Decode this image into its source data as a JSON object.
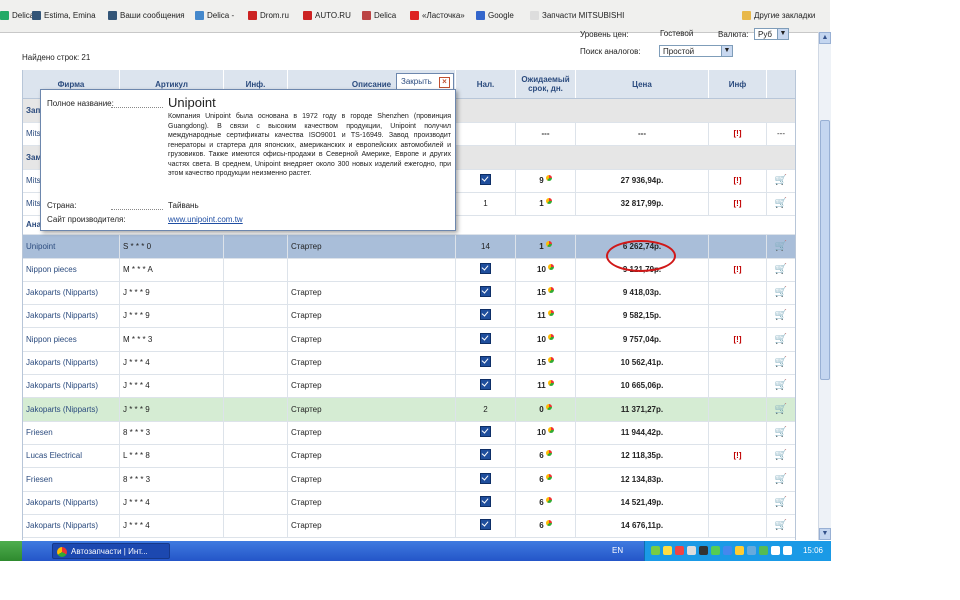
{
  "bookmarks": [
    {
      "label": "Delica",
      "icon": "flag-icon",
      "color": "#2a6"
    },
    {
      "label": "Estima, Emina",
      "icon": "forum-icon",
      "color": "#357"
    },
    {
      "label": "Ваши сообщения",
      "icon": "forum-icon",
      "color": "#357"
    },
    {
      "label": "Delica -",
      "icon": "page-icon",
      "color": "#48c"
    },
    {
      "label": "Drom.ru",
      "icon": "drom-icon",
      "color": "#c22"
    },
    {
      "label": "AUTO.RU",
      "icon": "autoru-icon",
      "color": "#c22"
    },
    {
      "label": "Delica",
      "icon": "page-icon",
      "color": "#b44"
    },
    {
      "label": "«Ласточка»",
      "icon": "page-icon",
      "color": "#d22"
    },
    {
      "label": "Google",
      "icon": "google-icon",
      "color": "#36c"
    },
    {
      "label": "Запчасти MITSUBISHI",
      "icon": "page-icon",
      "color": "#ddd"
    },
    {
      "label": "Другие закладки",
      "icon": "folder-icon",
      "color": "#e8b84a"
    }
  ],
  "controls": {
    "price_level_label": "Уровень цен:",
    "price_level_value": "Гостевой",
    "currency_label": "Валюта:",
    "currency_value": "Руб",
    "analog_search_label": "Поиск аналогов:",
    "analog_search_value": "Простой"
  },
  "found_rows": "Найдено строк: 21",
  "table": {
    "headers": {
      "firm": "Фирма",
      "article": "Артикул",
      "info": "Инф.",
      "description": "Описание",
      "availability": "Нал.",
      "expected": "Ожидаемый срок, дн.",
      "price": "Цена",
      "info2": "Инф"
    },
    "group_rows": {
      "analogs": "Аналоги (заменители) для запрошенного артикула"
    },
    "rows": [
      {
        "firm": "Зап",
        "article": "",
        "desc": "",
        "nal": "",
        "exp": "",
        "price": "",
        "inf": "",
        "cart": false,
        "type": "grp"
      },
      {
        "firm": "Mits",
        "article": "",
        "desc": "",
        "nal": "",
        "exp": "---",
        "price": "---",
        "inf": "[!]",
        "cart": false,
        "cart_text": "---",
        "type": "plain"
      },
      {
        "firm": "Зам",
        "article": "",
        "desc": "",
        "nal": "",
        "exp": "",
        "price": "",
        "inf": "",
        "cart": false,
        "type": "grp"
      },
      {
        "firm": "Mits",
        "article": "",
        "desc": "",
        "nal": "chk",
        "exp": "9",
        "price": "27 936,94р.",
        "inf": "[!]",
        "cart": true,
        "type": "plain"
      },
      {
        "firm": "Mits",
        "article": "",
        "desc": "",
        "nal": "1",
        "exp": "1",
        "price": "32 817,99р.",
        "inf": "[!]",
        "cart": true,
        "type": "plain"
      },
      {
        "firm": "Unipoint",
        "article": "S * * * 0",
        "desc": "Стартер",
        "nal": "14",
        "exp": "1",
        "price": "6 262,74р.",
        "inf": "",
        "cart": true,
        "type": "sel"
      },
      {
        "firm": "Nippon pieces",
        "article": "M * * * A",
        "desc": "",
        "nal": "chk",
        "exp": "10",
        "price": "9 121,79р.",
        "inf": "[!]",
        "cart": true,
        "type": "plain"
      },
      {
        "firm": "Jakoparts (Nipparts)",
        "article": "J * * * 9",
        "desc": "Стартер",
        "nal": "chk",
        "exp": "15",
        "price": "9 418,03р.",
        "inf": "",
        "cart": true,
        "type": "plain"
      },
      {
        "firm": "Jakoparts (Nipparts)",
        "article": "J * * * 9",
        "desc": "Стартер",
        "nal": "chk",
        "exp": "11",
        "price": "9 582,15р.",
        "inf": "",
        "cart": true,
        "type": "plain"
      },
      {
        "firm": "Nippon pieces",
        "article": "M * * * 3",
        "desc": "Стартер",
        "nal": "chk",
        "exp": "10",
        "price": "9 757,04р.",
        "inf": "[!]",
        "cart": true,
        "type": "plain"
      },
      {
        "firm": "Jakoparts (Nipparts)",
        "article": "J * * * 4",
        "desc": "Стартер",
        "nal": "chk",
        "exp": "15",
        "price": "10 562,41р.",
        "inf": "",
        "cart": true,
        "type": "plain"
      },
      {
        "firm": "Jakoparts (Nipparts)",
        "article": "J * * * 4",
        "desc": "Стартер",
        "nal": "chk",
        "exp": "11",
        "price": "10 665,06р.",
        "inf": "",
        "cart": true,
        "type": "plain"
      },
      {
        "firm": "Jakoparts (Nipparts)",
        "article": "J * * * 9",
        "desc": "Стартер",
        "nal": "2",
        "exp": "0",
        "price": "11 371,27р.",
        "inf": "",
        "cart": true,
        "type": "grn"
      },
      {
        "firm": "Friesen",
        "article": "8 * * * 3",
        "desc": "Стартер",
        "nal": "chk",
        "exp": "10",
        "price": "11 944,42р.",
        "inf": "",
        "cart": true,
        "type": "plain"
      },
      {
        "firm": "Lucas Electrical",
        "article": "L * * * 8",
        "desc": "Стартер",
        "nal": "chk",
        "exp": "6",
        "price": "12 118,35р.",
        "inf": "[!]",
        "cart": true,
        "type": "plain"
      },
      {
        "firm": "Friesen",
        "article": "8 * * * 3",
        "desc": "Стартер",
        "nal": "chk",
        "exp": "6",
        "price": "12 134,83р.",
        "inf": "",
        "cart": true,
        "type": "plain"
      },
      {
        "firm": "Jakoparts (Nipparts)",
        "article": "J * * * 4",
        "desc": "Стартер",
        "nal": "chk",
        "exp": "6",
        "price": "14 521,49р.",
        "inf": "",
        "cart": true,
        "type": "plain"
      },
      {
        "firm": "Jakoparts (Nipparts)",
        "article": "J * * * 4",
        "desc": "Стартер",
        "nal": "chk",
        "exp": "6",
        "price": "14 676,11р.",
        "inf": "",
        "cart": true,
        "type": "plain"
      }
    ]
  },
  "popup": {
    "close_label": "Закрыть",
    "full_name_label": "Полное название:",
    "full_name": "Unipoint",
    "description": "Компания Unipoint была основана в 1972 году в городе Shenzhen (провинция Guangdong). В связи с высоким качеством продукции, Unipoint получил международные сертификаты качества ISO9001 и TS-16949. Завод производит генераторы и стартера для японских, американских и европейских автомобилей и грузовиков. Также имеются офисы-продажи в Северной Америке, Европе и других частях света. В среднем, Unipoint внедряет около 300 новых изделий ежегодно, при этом качество продукции неизменно растет.",
    "country_label": "Страна:",
    "country": "Тайвань",
    "site_label": "Сайт производителя:",
    "site": "www.unipoint.com.tw"
  },
  "taskbar": {
    "task_label": "Автозапчасти | Инт...",
    "lang": "EN",
    "clock": "15:06"
  }
}
